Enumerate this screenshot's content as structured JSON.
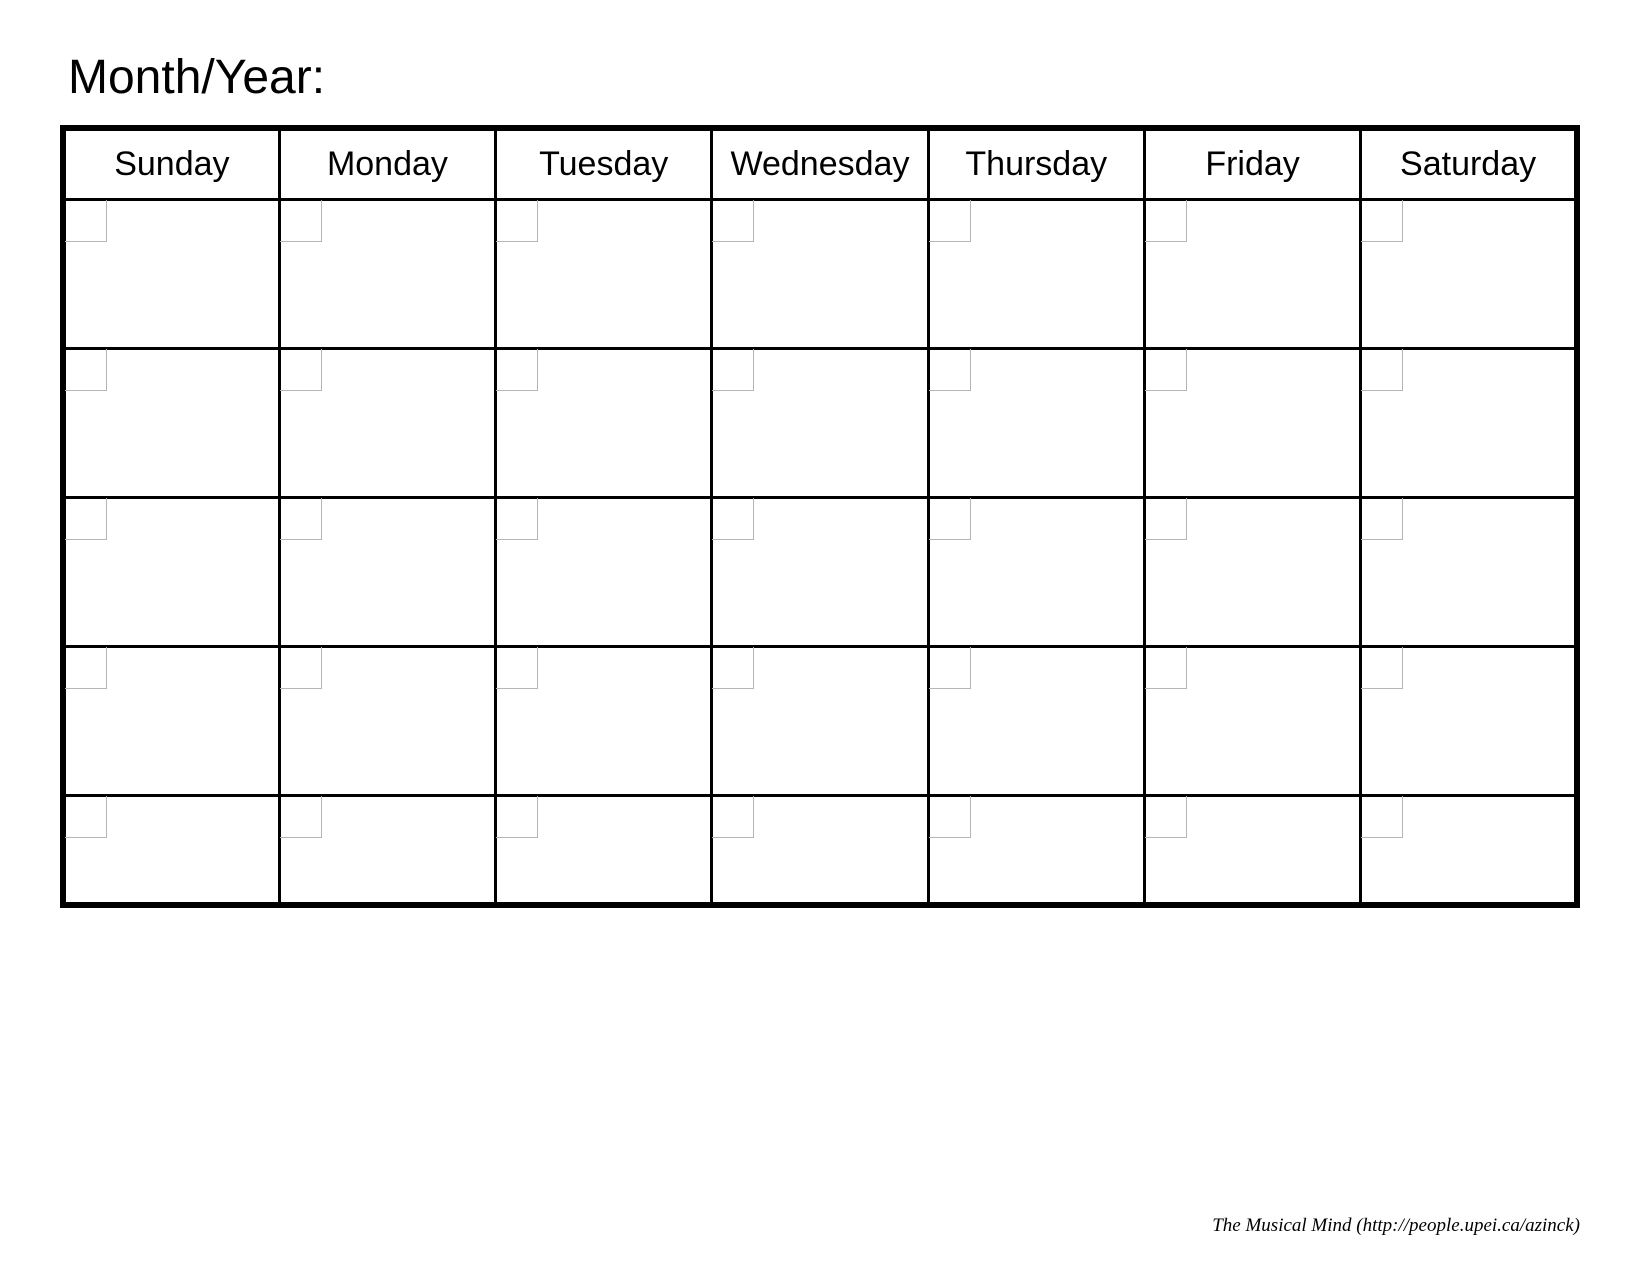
{
  "title": "Month/Year:",
  "days": [
    "Sunday",
    "Monday",
    "Tuesday",
    "Wednesday",
    "Thursday",
    "Friday",
    "Saturday"
  ],
  "weeks": 5,
  "footer": {
    "text": "The Musical Mind   (http://people.upei.ca/azinck)"
  }
}
